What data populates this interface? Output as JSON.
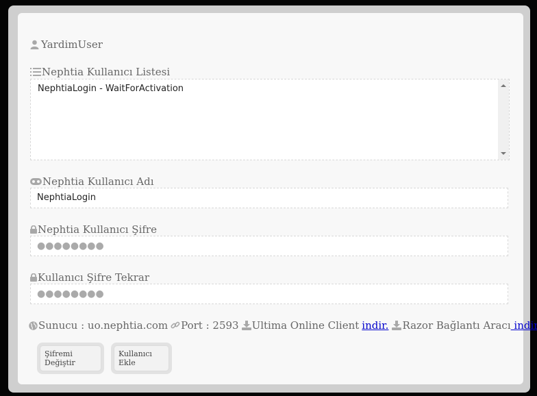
{
  "user": {
    "name": "YardimUser",
    "icon": "user-icon"
  },
  "user_list": {
    "label": "Nephtia Kullanıcı Listesi",
    "icon": "list-icon",
    "items": [
      "NephtiaLogin - WaitForActivation"
    ]
  },
  "username": {
    "label": "Nephtia Kullanıcı Adı",
    "icon": "gamepad-icon",
    "value": "NephtiaLogin"
  },
  "password": {
    "label": "Nephtia Kullanıcı Şifre",
    "icon": "lock-icon",
    "value": "●●●●●●●●"
  },
  "password_repeat": {
    "label": "Kullanıcı Şifre Tekrar",
    "icon": "lock-icon",
    "value": "●●●●●●●●"
  },
  "info": {
    "server": "Sunucu : uo.nephtia.com",
    "port": "Port : 2593",
    "client_text": "Ultima Online Client",
    "client_link": "indir.",
    "razor_text": "Razor Bağlantı Aracı",
    "razor_link": " indir."
  },
  "buttons": {
    "change_password": "Şifremi Değiştir",
    "add_user": "Kullanıcı Ekle"
  }
}
